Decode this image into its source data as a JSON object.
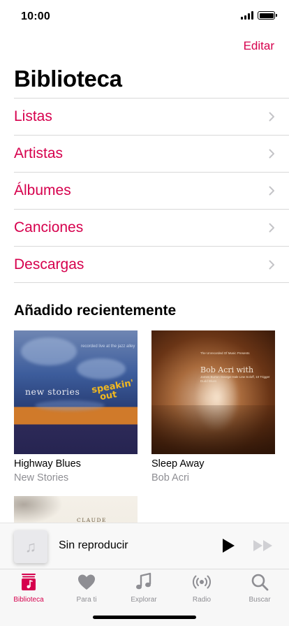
{
  "status": {
    "time": "10:00"
  },
  "header": {
    "edit_label": "Editar",
    "title": "Biblioteca"
  },
  "menu": {
    "items": [
      {
        "label": "Listas"
      },
      {
        "label": "Artistas"
      },
      {
        "label": "Álbumes"
      },
      {
        "label": "Canciones"
      },
      {
        "label": "Descargas"
      }
    ]
  },
  "recent": {
    "title": "Añadido recientemente",
    "albums": [
      {
        "title": "Highway Blues",
        "artist": "New Stories",
        "cover_text": "new stories",
        "cover_word_1": "speakin'",
        "cover_word_2": "out",
        "cover_small": "recorded live at the jazz alley"
      },
      {
        "title": "Sleep Away",
        "artist": "Bob Acri",
        "cover_top": "The Unrecorded Of Music Presents",
        "cover_name": "Bob Acri with",
        "cover_small": "James Burton George Hale Lew Soloff, 10 Trigger Dudd Blues"
      },
      {
        "composer": "CLAUDE DEBUSSY"
      }
    ]
  },
  "player": {
    "title": "Sin reproducir",
    "art_icon": "music-note-icon"
  },
  "tabs": [
    {
      "label": "Biblioteca",
      "icon": "library-icon",
      "active": true
    },
    {
      "label": "Para ti",
      "icon": "heart-icon",
      "active": false
    },
    {
      "label": "Explorar",
      "icon": "music-note-icon",
      "active": false
    },
    {
      "label": "Radio",
      "icon": "radio-icon",
      "active": false
    },
    {
      "label": "Buscar",
      "icon": "search-icon",
      "active": false
    }
  ],
  "colors": {
    "accent": "#d6004d",
    "secondary_text": "#8e8e93",
    "separator": "#d8d8d8"
  }
}
